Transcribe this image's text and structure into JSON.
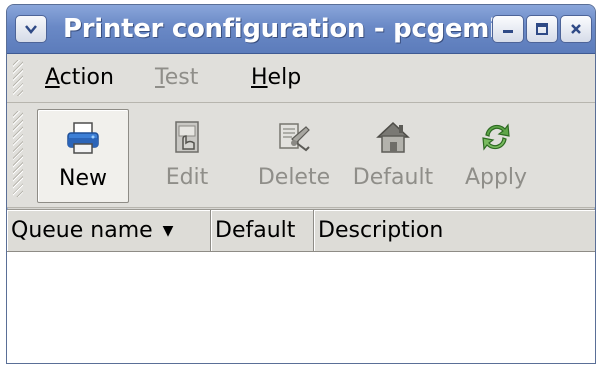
{
  "window": {
    "title": "Printer configuration - pcgemila",
    "controls": [
      "minimize",
      "maximize",
      "close"
    ]
  },
  "menubar": {
    "items": [
      {
        "label": "Action",
        "mnemonic": "A",
        "rest": "ction",
        "enabled": true
      },
      {
        "label": "Test",
        "mnemonic": "T",
        "rest": "est",
        "enabled": false
      },
      {
        "label": "Help",
        "mnemonic": "H",
        "rest": "elp",
        "enabled": true
      }
    ]
  },
  "toolbar": {
    "buttons": [
      {
        "label": "New",
        "icon": "printer-icon",
        "enabled": true
      },
      {
        "label": "Edit",
        "icon": "edit-icon",
        "enabled": false
      },
      {
        "label": "Delete",
        "icon": "delete-icon",
        "enabled": false
      },
      {
        "label": "Default",
        "icon": "home-icon",
        "enabled": false
      },
      {
        "label": "Apply",
        "icon": "apply-icon",
        "enabled": false
      }
    ]
  },
  "queue_list": {
    "columns": [
      {
        "label": "Queue name",
        "sort": "descending"
      },
      {
        "label": "Default"
      },
      {
        "label": "Description"
      }
    ],
    "rows": []
  },
  "colors": {
    "titlebar": "#6a89c6",
    "window_bg": "#d7d6d2",
    "disabled_text": "#8f8e89"
  }
}
